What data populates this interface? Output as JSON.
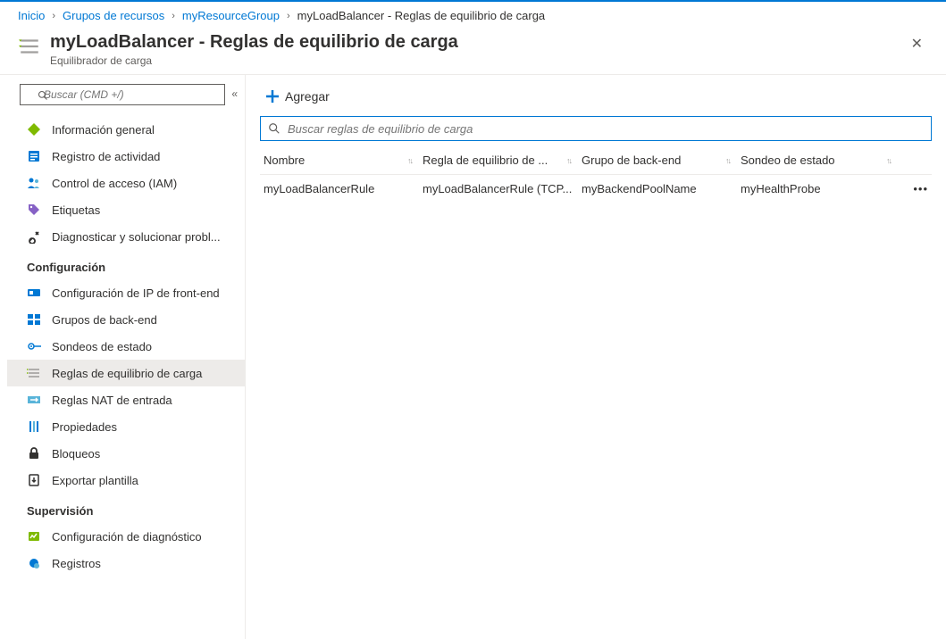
{
  "colors": {
    "accent": "#0078d4"
  },
  "breadcrumb": {
    "items": [
      {
        "label": "Inicio",
        "link": true
      },
      {
        "label": "Grupos de recursos",
        "link": true
      },
      {
        "label": "myResourceGroup",
        "link": true
      },
      {
        "label": "myLoadBalancer - Reglas de equilibrio de carga",
        "link": false
      }
    ]
  },
  "header": {
    "title": "myLoadBalancer - Reglas de equilibrio de carga",
    "subtitle": "Equilibrador de carga"
  },
  "sidebar": {
    "search_placeholder": "Buscar (CMD +/)",
    "groups": [
      {
        "title": null,
        "items": [
          {
            "key": "overview",
            "label": "Información general"
          },
          {
            "key": "activity-log",
            "label": "Registro de actividad"
          },
          {
            "key": "access-control",
            "label": "Control de acceso (IAM)"
          },
          {
            "key": "tags",
            "label": "Etiquetas"
          },
          {
            "key": "diagnose",
            "label": "Diagnosticar y solucionar probl..."
          }
        ]
      },
      {
        "title": "Configuración",
        "items": [
          {
            "key": "frontend-ip",
            "label": "Configuración de IP de front-end"
          },
          {
            "key": "backend-pools",
            "label": "Grupos de back-end"
          },
          {
            "key": "health-probes",
            "label": "Sondeos de estado"
          },
          {
            "key": "lb-rules",
            "label": "Reglas de equilibrio de carga",
            "active": true
          },
          {
            "key": "nat-rules",
            "label": "Reglas NAT de entrada"
          },
          {
            "key": "properties",
            "label": "Propiedades"
          },
          {
            "key": "locks",
            "label": "Bloqueos"
          },
          {
            "key": "export-template",
            "label": "Exportar plantilla"
          }
        ]
      },
      {
        "title": "Supervisión",
        "items": [
          {
            "key": "diagnostic-settings",
            "label": "Configuración de diagnóstico"
          },
          {
            "key": "logs",
            "label": "Registros"
          }
        ]
      }
    ]
  },
  "toolbar": {
    "add_label": "Agregar"
  },
  "filter": {
    "placeholder": "Buscar reglas de equilibrio de carga"
  },
  "grid": {
    "columns": {
      "name": "Nombre",
      "rule": "Regla de equilibrio de ...",
      "pool": "Grupo de back-end",
      "probe": "Sondeo de estado"
    },
    "rows": [
      {
        "name": "myLoadBalancerRule",
        "rule": "myLoadBalancerRule (TCP...",
        "pool": "myBackendPoolName",
        "probe": "myHealthProbe"
      }
    ]
  }
}
